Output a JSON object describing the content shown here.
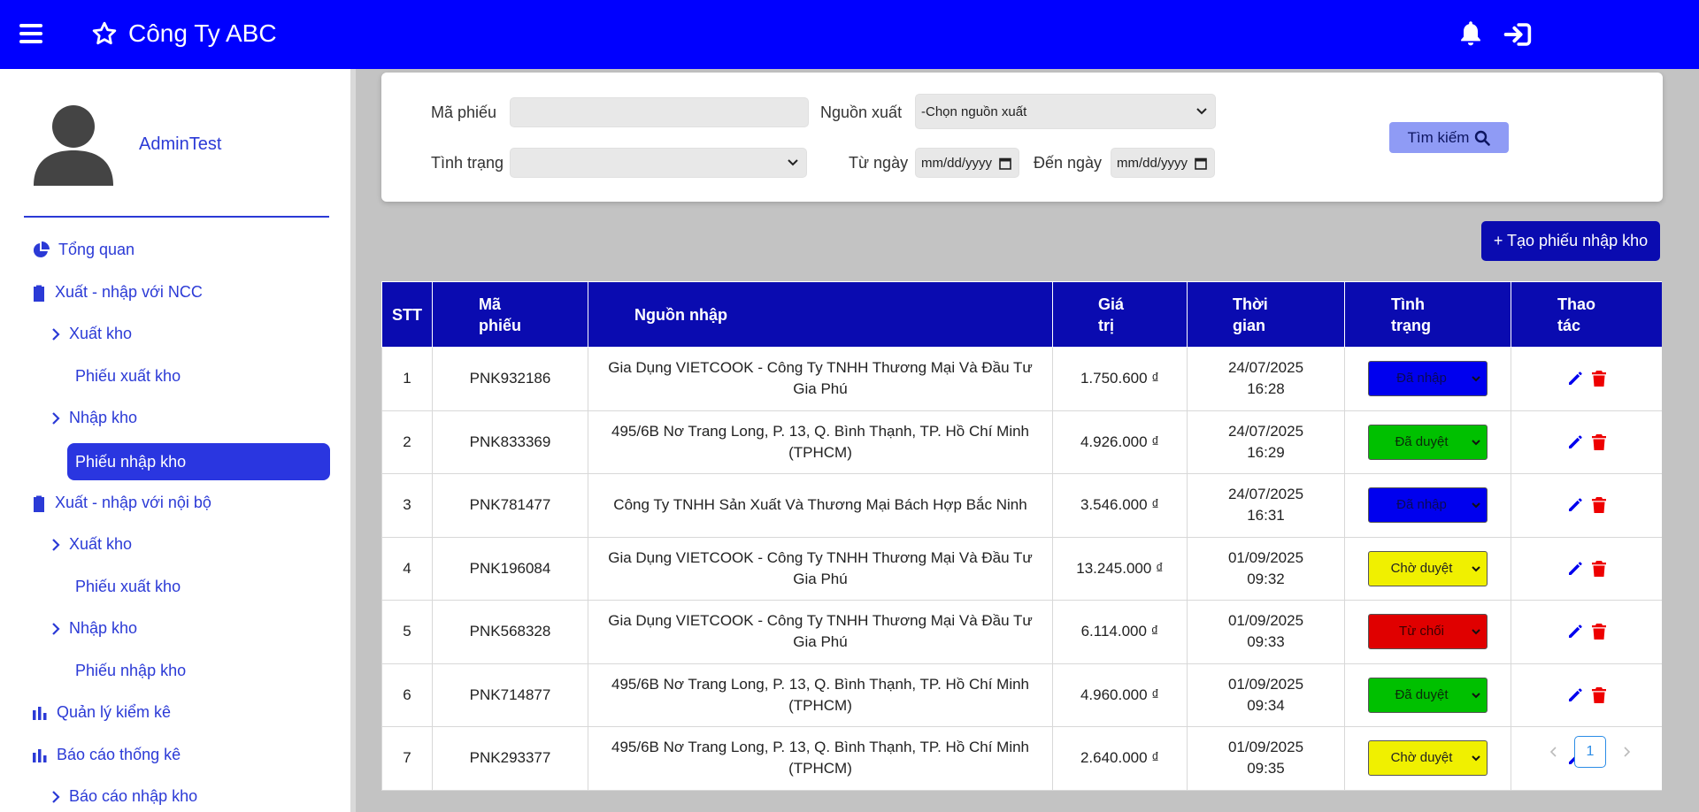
{
  "header": {
    "company_name": "Công Ty ABC",
    "icons": [
      "menu-icon",
      "star-icon",
      "bell-icon",
      "login-icon"
    ],
    "bg_color": "#0000ff"
  },
  "sidebar": {
    "username": "AdminTest",
    "items": [
      {
        "label": "Tổng quan",
        "icon": "pie-chart-icon"
      },
      {
        "label": "Xuất - nhập với NCC",
        "icon": "clipboard-icon"
      },
      {
        "label": "Xuất kho",
        "icon": "chevron-right-icon"
      },
      {
        "label": "Phiếu xuất kho"
      },
      {
        "label": "Nhập kho",
        "icon": "chevron-right-icon"
      },
      {
        "label": "Phiếu nhập kho",
        "active": true
      },
      {
        "label": "Xuất - nhập với nội bộ",
        "icon": "clipboard-icon"
      },
      {
        "label": "Xuất kho",
        "icon": "chevron-right-icon"
      },
      {
        "label": "Phiếu xuất kho"
      },
      {
        "label": "Nhập kho",
        "icon": "chevron-right-icon"
      },
      {
        "label": "Phiếu nhập kho"
      },
      {
        "label": "Quản lý kiểm kê",
        "icon": "bar-chart-icon"
      },
      {
        "label": "Báo cáo thống kê",
        "icon": "bar-chart-icon"
      },
      {
        "label": "Báo cáo nhập kho",
        "icon": "chevron-right-icon"
      }
    ]
  },
  "search": {
    "ma_phieu_label": "Mã phiếu",
    "ma_phieu_value": "",
    "nguon_xuat_label": "Nguồn xuất",
    "nguon_xuat_value": "-Chọn nguồn xuất",
    "tinh_trang_label": "Tình trạng",
    "tinh_trang_value": "",
    "tu_ngay_label": "Từ ngày",
    "tu_ngay_value": "mm/dd/yyyy",
    "den_ngay_label": "Đến ngày",
    "den_ngay_value": "mm/dd/yyyy",
    "button_label": "Tìm kiếm"
  },
  "create_button_label": "+ Tạo phiếu nhập kho",
  "table": {
    "headers": {
      "stt": "STT",
      "ma_phieu_1": "Mã",
      "ma_phieu_2": "phiếu",
      "nguon_nhap": "Nguồn nhập",
      "gia_tri_1": "Giá",
      "gia_tri_2": "trị",
      "thoi_gian_1": "Thời",
      "thoi_gian_2": "gian",
      "tinh_trang_1": "Tình",
      "tinh_trang_2": "trạng",
      "thao_tac_1": "Thao",
      "thao_tac_2": "tác"
    },
    "rows": [
      {
        "stt": "1",
        "code": "PNK932186",
        "source": "Gia Dụng VIETCOOK - Công Ty TNHH Thương Mại Và Đầu Tư Gia Phú",
        "value": "1.750.600 ₫",
        "date": "24/07/2025",
        "time": "16:28",
        "status": "Đã nhập",
        "status_bg": "#0000ee",
        "status_fg": "#0a0a55"
      },
      {
        "stt": "2",
        "code": "PNK833369",
        "source": "495/6B Nơ Trang Long, P. 13, Q. Bình Thạnh, TP. Hồ Chí Minh (TPHCM)",
        "value": "4.926.000 ₫",
        "date": "24/07/2025",
        "time": "16:29",
        "status": "Đã duyệt",
        "status_bg": "#00c000",
        "status_fg": "#0a2a0a"
      },
      {
        "stt": "3",
        "code": "PNK781477",
        "source": "Công Ty TNHH Sản Xuất Và Thương Mại Bách Hợp Bắc Ninh",
        "value": "3.546.000 ₫",
        "date": "24/07/2025",
        "time": "16:31",
        "status": "Đã nhập",
        "status_bg": "#0000ee",
        "status_fg": "#0a0a55"
      },
      {
        "stt": "4",
        "code": "PNK196084",
        "source": "Gia Dụng VIETCOOK - Công Ty TNHH Thương Mại Và Đầu Tư Gia Phú",
        "value": "13.245.000 ₫",
        "date": "01/09/2025",
        "time": "09:32",
        "status": "Chờ duyệt",
        "status_bg": "#f0f000",
        "status_fg": "#222222"
      },
      {
        "stt": "5",
        "code": "PNK568328",
        "source": "Gia Dụng VIETCOOK - Công Ty TNHH Thương Mại Và Đầu Tư Gia Phú",
        "value": "6.114.000 ₫",
        "date": "01/09/2025",
        "time": "09:33",
        "status": "Từ chối",
        "status_bg": "#e00000",
        "status_fg": "#3a0000"
      },
      {
        "stt": "6",
        "code": "PNK714877",
        "source": "495/6B Nơ Trang Long, P. 13, Q. Bình Thạnh, TP. Hồ Chí Minh (TPHCM)",
        "value": "4.960.000 ₫",
        "date": "01/09/2025",
        "time": "09:34",
        "status": "Đã duyệt",
        "status_bg": "#00c000",
        "status_fg": "#0a2a0a"
      },
      {
        "stt": "7",
        "code": "PNK293377",
        "source": "495/6B Nơ Trang Long, P. 13, Q. Bình Thạnh, TP. Hồ Chí Minh (TPHCM)",
        "value": "2.640.000 ₫",
        "date": "01/09/2025",
        "time": "09:35",
        "status": "Chờ duyệt",
        "status_bg": "#f0f000",
        "status_fg": "#222222"
      }
    ],
    "row_icons": [
      "pencil-icon",
      "trash-icon"
    ],
    "edit_color": "#0000ee",
    "delete_color": "#ee0000"
  },
  "pagination": {
    "current_page": "1"
  }
}
